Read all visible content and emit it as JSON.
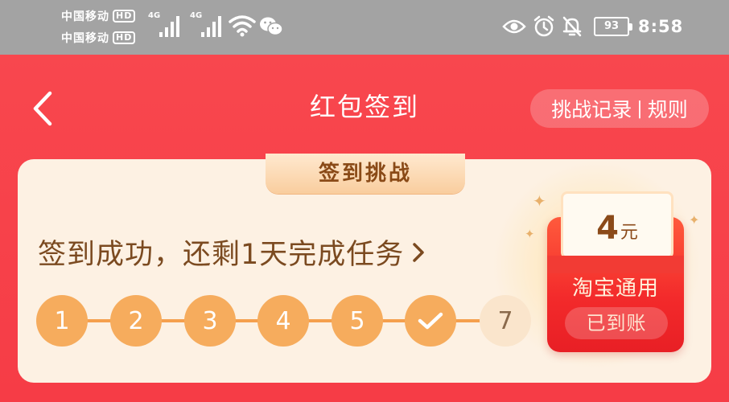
{
  "status_bar": {
    "carrier_1": "中国移动",
    "carrier_2": "中国移动",
    "hd_1": "HD",
    "hd_2": "HD",
    "net_1": "4G",
    "net_2": "4G",
    "battery": "93",
    "time": "8:58",
    "icons": [
      "wifi-icon",
      "wechat-icon",
      "eye-icon",
      "alarm-icon",
      "bell-off-icon"
    ]
  },
  "header": {
    "title": "红包签到",
    "record_link": "挑战记录",
    "separator": "|",
    "rules_link": "规则"
  },
  "card": {
    "tab_label": "签到挑战",
    "message": "签到成功，还剩1天完成任务",
    "steps": [
      {
        "label": "1",
        "done": true
      },
      {
        "label": "2",
        "done": true
      },
      {
        "label": "3",
        "done": true
      },
      {
        "label": "4",
        "done": true
      },
      {
        "label": "5",
        "done": true
      },
      {
        "label": "",
        "done": true,
        "current": true
      },
      {
        "label": "7",
        "done": false
      }
    ]
  },
  "reward": {
    "amount": "4",
    "unit": "元",
    "label": "淘宝通用",
    "status": "已到账"
  },
  "colors": {
    "header_red": "#f6444b",
    "card_bg": "#fdf1e3",
    "step_done": "#f6ac5d",
    "step_todo": "#fae5cc",
    "text_brown": "#7b4a20"
  }
}
